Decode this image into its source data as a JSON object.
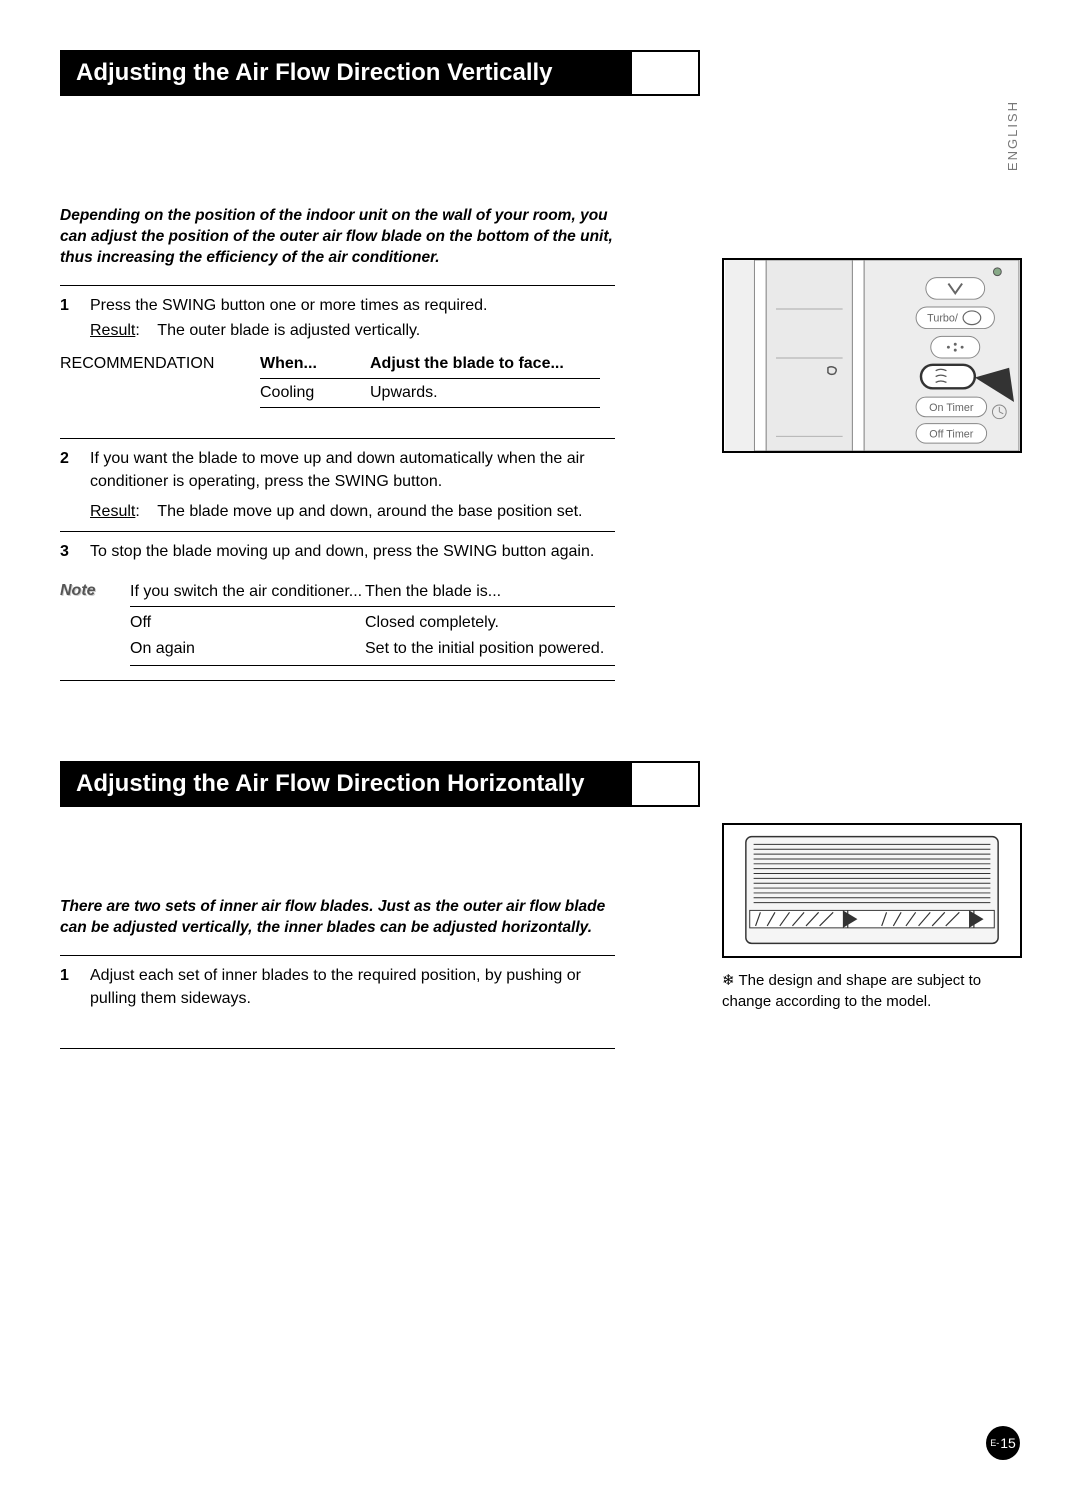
{
  "language_tab": "ENGLISH",
  "section1": {
    "title": "Adjusting the Air Flow Direction Vertically",
    "intro": "Depending on the position of the indoor unit on the wall of your room, you can adjust the position of the outer air flow blade on the bottom of the unit, thus increasing the efficiency of the air conditioner.",
    "step1": {
      "num": "1",
      "text": "Press the SWING button one or more times as required.",
      "result_label": "Result",
      "result_text": "The outer blade is adjusted vertically."
    },
    "recommendation": {
      "label": "RECOMMENDATION",
      "header_when": "When...",
      "header_adjust": "Adjust the blade to face...",
      "row_when": "Cooling",
      "row_adjust": "Upwards."
    },
    "step2": {
      "num": "2",
      "text": "If you want the blade to move up and down automatically when the air conditioner is operating, press the SWING button.",
      "result_label": "Result",
      "result_text": "The blade move up and down, around the base position set."
    },
    "step3": {
      "num": "3",
      "text": "To stop the blade moving up and down, press the SWING button again."
    },
    "note": {
      "label": "Note",
      "header_switch": "If you switch the air conditioner...",
      "header_blade": "Then the blade is...",
      "row1_switch": "Off",
      "row1_blade": "Closed completely.",
      "row2_switch": "On again",
      "row2_blade": "Set to the initial position powered."
    }
  },
  "section2": {
    "title": "Adjusting the Air Flow Direction Horizontally",
    "intro": "There are two sets of inner air flow blades. Just as the outer air flow blade can be adjusted vertically, the inner blades can be adjusted horizontally.",
    "step1": {
      "num": "1",
      "text": "Adjust each set of inner blades to the required position, by pushing or pulling them sideways."
    }
  },
  "remote_buttons": {
    "turbo": "Turbo",
    "on_timer": "On Timer",
    "off_timer": "Off Timer"
  },
  "disclaimer_symbol": "❄",
  "disclaimer": "The design and shape are subject to change according to the model.",
  "page_prefix": "E-",
  "page_number": "15"
}
